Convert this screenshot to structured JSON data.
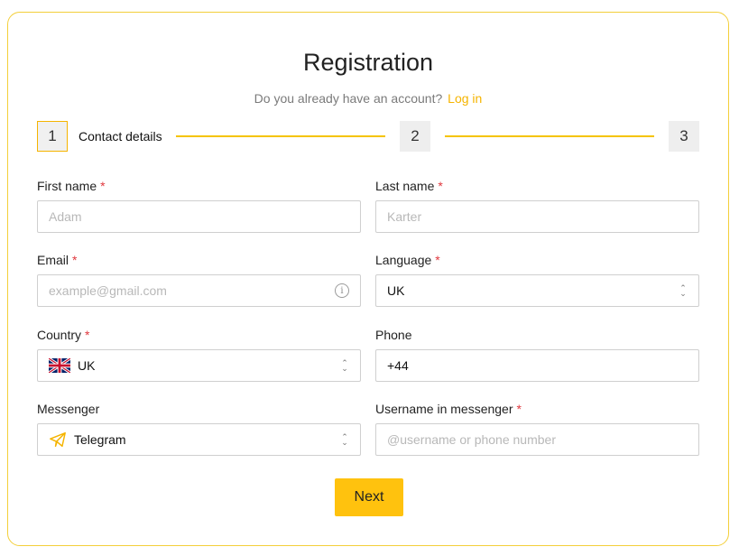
{
  "title": "Registration",
  "subtitle": {
    "text": "Do you already have an account?",
    "link": "Log in"
  },
  "stepper": {
    "steps": [
      {
        "number": "1",
        "label": "Contact details",
        "active": true
      },
      {
        "number": "2"
      },
      {
        "number": "3"
      }
    ]
  },
  "form": {
    "required_mark": "*",
    "first_name": {
      "label": "First name",
      "placeholder": "Adam"
    },
    "last_name": {
      "label": "Last name",
      "placeholder": "Karter"
    },
    "email": {
      "label": "Email",
      "placeholder": "example@gmail.com",
      "icon": "info-icon"
    },
    "language": {
      "label": "Language",
      "value": "UK"
    },
    "country": {
      "label": "Country",
      "value": "UK",
      "icon": "uk-flag-icon"
    },
    "phone": {
      "label": "Phone",
      "value": "+44"
    },
    "messenger": {
      "label": "Messenger",
      "value": "Telegram",
      "icon": "telegram-icon"
    },
    "username": {
      "label": "Username in messenger",
      "placeholder": "@username or phone number"
    }
  },
  "next_label": "Next",
  "colors": {
    "accent": "#ffc20e",
    "border": "#f3cf3a",
    "required": "#e0383e"
  }
}
